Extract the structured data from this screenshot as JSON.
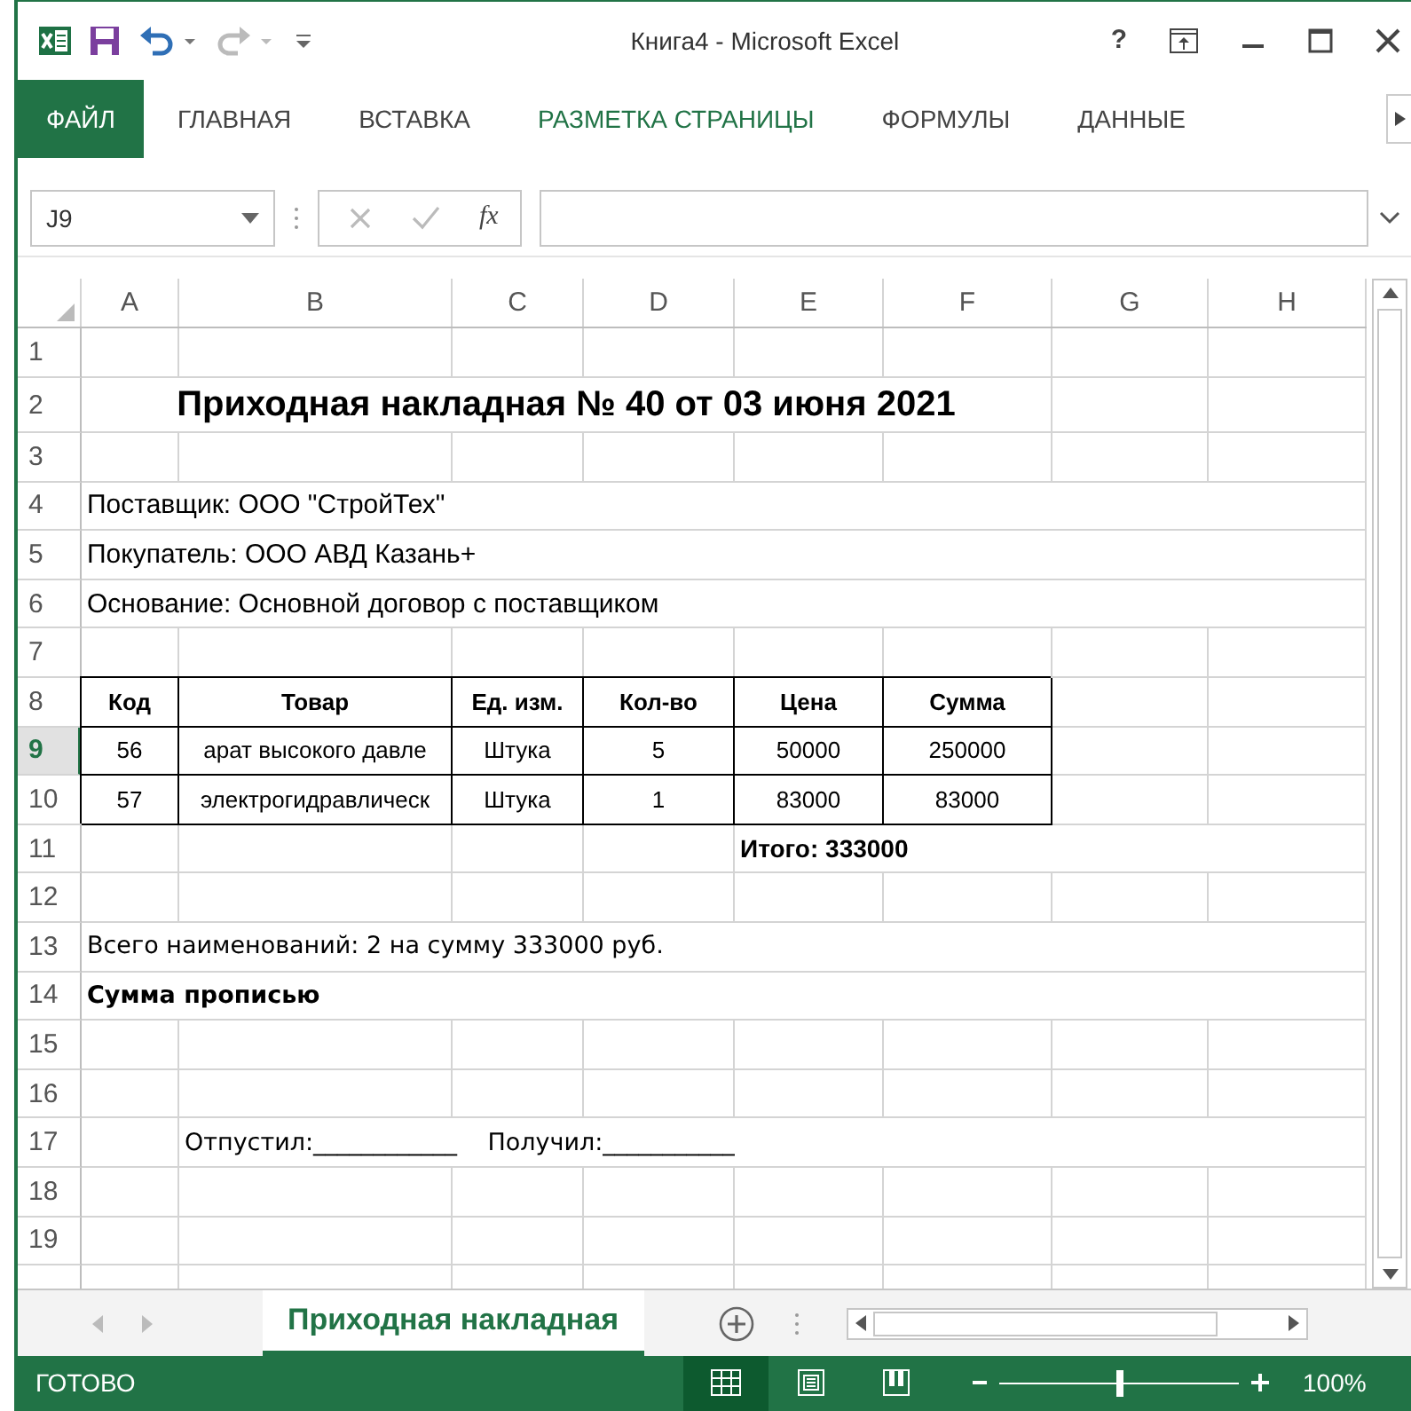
{
  "window": {
    "title": "Книга4 - Microsoft Excel",
    "help": "?"
  },
  "ribbon_tabs": [
    {
      "label": "ФАЙЛ",
      "kind": "file",
      "selected": false
    },
    {
      "label": "ГЛАВНАЯ",
      "kind": "tab",
      "selected": false
    },
    {
      "label": "ВСТАВКА",
      "kind": "tab",
      "selected": false
    },
    {
      "label": "РАЗМЕТКА СТРАНИЦЫ",
      "kind": "tab",
      "selected": true
    },
    {
      "label": "ФОРМУЛЫ",
      "kind": "tab",
      "selected": false
    },
    {
      "label": "ДАННЫЕ",
      "kind": "tab",
      "selected": false
    }
  ],
  "formula_bar": {
    "name_box": "J9",
    "function_label": "fx"
  },
  "sheet": {
    "columns": [
      "A",
      "B",
      "C",
      "D",
      "E",
      "F",
      "G",
      "H"
    ],
    "rows": [
      {
        "number": "1",
        "selected": false
      },
      {
        "number": "2",
        "selected": false,
        "cells": [
          {
            "kind": "title",
            "text": "Приходная накладная № 40 от 03 июня 2021"
          }
        ]
      },
      {
        "number": "3",
        "selected": false
      },
      {
        "number": "4",
        "selected": false,
        "cells": [
          {
            "kind": "text",
            "text": "Поставщик: ООО \"СтройТех\""
          }
        ]
      },
      {
        "number": "5",
        "selected": false,
        "cells": [
          {
            "kind": "text",
            "text": "Покупатель: ООО АВД Казань+"
          }
        ]
      },
      {
        "number": "6",
        "selected": false,
        "cells": [
          {
            "kind": "text",
            "text": "Основание: Основной договор с поставщиком"
          }
        ]
      },
      {
        "number": "7",
        "selected": false
      },
      {
        "number": "8",
        "selected": false,
        "cells": [
          {
            "kind": "header",
            "text": "Код"
          },
          {
            "kind": "header",
            "text": "Товар"
          },
          {
            "kind": "header",
            "text": "Ед. изм."
          },
          {
            "kind": "header",
            "text": "Кол-во"
          },
          {
            "kind": "header",
            "text": "Цена"
          },
          {
            "kind": "header",
            "text": "Сумма"
          }
        ]
      },
      {
        "number": "9",
        "selected": true,
        "cells": [
          {
            "kind": "data",
            "text": "56"
          },
          {
            "kind": "data",
            "text": "арат высокого давле"
          },
          {
            "kind": "data",
            "text": "Штука"
          },
          {
            "kind": "data",
            "text": "5"
          },
          {
            "kind": "data",
            "text": "50000"
          },
          {
            "kind": "data",
            "text": "250000"
          }
        ]
      },
      {
        "number": "10",
        "selected": false,
        "cells": [
          {
            "kind": "data",
            "text": "57"
          },
          {
            "kind": "data",
            "text": "электрогидравлическ"
          },
          {
            "kind": "data",
            "text": "Штука"
          },
          {
            "kind": "data",
            "text": "1"
          },
          {
            "kind": "data",
            "text": "83000"
          },
          {
            "kind": "data",
            "text": "83000"
          }
        ]
      },
      {
        "number": "11",
        "selected": false,
        "cells": [
          {},
          {},
          {},
          {},
          {
            "kind": "total",
            "text": "Итого: 333000"
          }
        ]
      },
      {
        "number": "12",
        "selected": false
      },
      {
        "number": "13",
        "selected": false,
        "cells": [
          {
            "kind": "note",
            "text": "Всего наименований: 2 на сумму 333000 руб."
          }
        ]
      },
      {
        "number": "14",
        "selected": false,
        "cells": [
          {
            "kind": "note-bold",
            "text": "Сумма прописью"
          }
        ]
      },
      {
        "number": "15",
        "selected": false
      },
      {
        "number": "16",
        "selected": false
      },
      {
        "number": "17",
        "selected": false,
        "cells": [
          {},
          {
            "kind": "note",
            "text": "Отпустил:____________    Получил:___________"
          }
        ]
      },
      {
        "number": "18",
        "selected": false
      },
      {
        "number": "19",
        "selected": false
      }
    ]
  },
  "sheet_tabs": [
    {
      "label": "Приходная накладная",
      "selected": true
    }
  ],
  "status_bar": {
    "status": "ГОТОВО",
    "views": [
      {
        "kind": "normal",
        "selected": true
      },
      {
        "kind": "page-layout",
        "selected": false
      },
      {
        "kind": "page-break",
        "selected": false
      }
    ],
    "zoom": {
      "level": 0.5,
      "reading": "100%"
    }
  }
}
